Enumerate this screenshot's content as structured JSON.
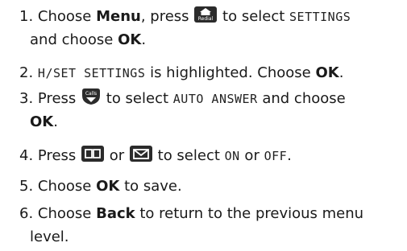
{
  "steps": [
    {
      "num": "1.",
      "t1": "Choose ",
      "b1": "Menu",
      "t2": ", press ",
      "t3": " to select ",
      "lcd1": "SETTINGS",
      "t4": "and choose ",
      "b2": "OK",
      "t5": "."
    },
    {
      "num": "2.",
      "lcd1": "H/SET SETTINGS",
      "t1": " is highlighted. Choose ",
      "b1": "OK",
      "t2": "."
    },
    {
      "num": "3.",
      "t1": "Press ",
      "t2": " to select ",
      "lcd1": "AUTO ANSWER",
      "t3": " and choose",
      "b1": "OK",
      "t4": "."
    },
    {
      "num": "4.",
      "t1": "Press ",
      "t2": " or ",
      "t3": " to select ",
      "lcd1": "ON",
      "t4": " or ",
      "lcd2": "OFF",
      "t5": "."
    },
    {
      "num": "5.",
      "t1": "Choose ",
      "b1": "OK",
      "t2": " to save."
    },
    {
      "num": "6.",
      "t1": "Choose ",
      "b1": "Back",
      "t2": " to return to the previous menu",
      "t3": "level."
    }
  ],
  "icons": {
    "redial_label": "Redial",
    "calls_label": "Calls"
  },
  "colors": {
    "text": "#1a1a1a",
    "key_fill": "#2b2b2b"
  }
}
